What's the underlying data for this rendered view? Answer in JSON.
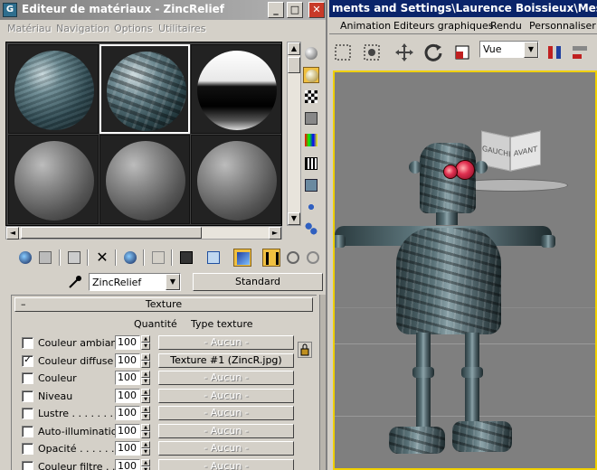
{
  "material_editor": {
    "window_title": "Editeur de matériaux - ZincRelief",
    "app_icon_letter": "G",
    "title_buttons": {
      "minimize": "_",
      "maximize": "□",
      "close": "✕"
    },
    "menu": [
      "Matériau",
      "Navigation",
      "Options",
      "Utilitaires"
    ],
    "slots": [
      "sph-zinc",
      "sph-relief",
      "sph-chrome",
      "sph-grey",
      "sph-grey",
      "sph-grey"
    ],
    "material_name": "ZincRelief",
    "material_type": "Standard",
    "rollout_title": "Texture",
    "rollout_toggle": "–",
    "col_quantity": "Quantité",
    "col_map_type": "Type texture",
    "maps": [
      {
        "label": "Couleur ambiante",
        "checked": false,
        "amount": "100",
        "map": "- Aucun -"
      },
      {
        "label": "Couleur diffuse . .",
        "checked": true,
        "amount": "100",
        "map": "Texture #1 (ZincR.jpg)"
      },
      {
        "label": "Couleur",
        "checked": false,
        "amount": "100",
        "map": "- Aucun -"
      },
      {
        "label": "Niveau",
        "checked": false,
        "amount": "100",
        "map": "- Aucun -"
      },
      {
        "label": "Lustre . . . . . . . .",
        "checked": false,
        "amount": "100",
        "map": "- Aucun -"
      },
      {
        "label": "Auto-illumination .",
        "checked": false,
        "amount": "100",
        "map": "- Aucun -"
      },
      {
        "label": "Opacité . . . . . .",
        "checked": false,
        "amount": "100",
        "map": "- Aucun -"
      },
      {
        "label": "Couleur filtre . .",
        "checked": false,
        "amount": "100",
        "map": "- Aucun -"
      }
    ]
  },
  "max_window": {
    "title": "ments and Settings\\Laurence Boissieux\\Mes doc",
    "menu": [
      "Animation",
      "Editeurs graphiques",
      "Rendu",
      "Personnaliser"
    ],
    "view_combo": "Vue",
    "viewcube": {
      "left": "GAUCHE",
      "front": "AVANT"
    }
  },
  "colors": {
    "viewport_border": "#f0d000",
    "title_active": "#0a246a",
    "title_inactive": "#7f7f7f"
  }
}
